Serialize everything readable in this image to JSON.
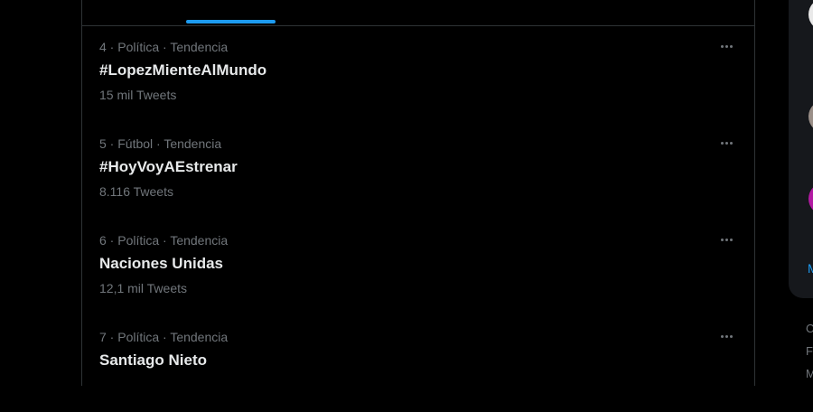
{
  "trends": [
    {
      "meta": "4 · Política · Tendencia",
      "title": "#LopezMienteAlMundo",
      "count": "15 mil Tweets"
    },
    {
      "meta": "5 · Fútbol · Tendencia",
      "title": "#HoyVoyAEstrenar",
      "count": "8.116 Tweets"
    },
    {
      "meta": "6 · Política · Tendencia",
      "title": "Naciones Unidas",
      "count": "12,1 mil Tweets"
    },
    {
      "meta": "7 · Política · Tendencia",
      "title": "Santiago Nieto",
      "count": ""
    }
  ],
  "sidebar": {
    "link_partial": "M",
    "footer_lines": [
      "C",
      "F",
      "M"
    ]
  },
  "colors": {
    "accent": "#1d9bf0",
    "background": "#000000",
    "secondary_text": "#71767b"
  },
  "icons": {
    "more": "more-horizontal-icon"
  }
}
